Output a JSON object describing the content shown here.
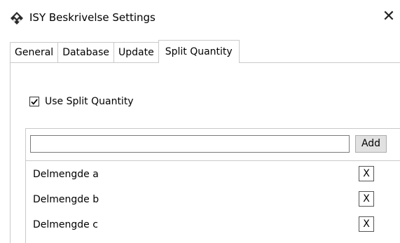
{
  "window": {
    "title": "ISY Beskrivelse Settings",
    "close_glyph": "✕",
    "app_icon": "isy-diamond-icon"
  },
  "tabs": [
    {
      "label": "General",
      "active": false
    },
    {
      "label": "Database",
      "active": false
    },
    {
      "label": "Update",
      "active": false
    },
    {
      "label": "Split Quantity",
      "active": true
    }
  ],
  "split_quantity": {
    "use_split_quantity": {
      "label": "Use Split Quantity",
      "checked": true
    },
    "new_item_input": {
      "value": "",
      "placeholder": ""
    },
    "add_label": "Add",
    "items": [
      {
        "label": "Delmengde a",
        "remove_label": "X"
      },
      {
        "label": "Delmengde b",
        "remove_label": "X"
      },
      {
        "label": "Delmengde c",
        "remove_label": "X"
      }
    ]
  }
}
